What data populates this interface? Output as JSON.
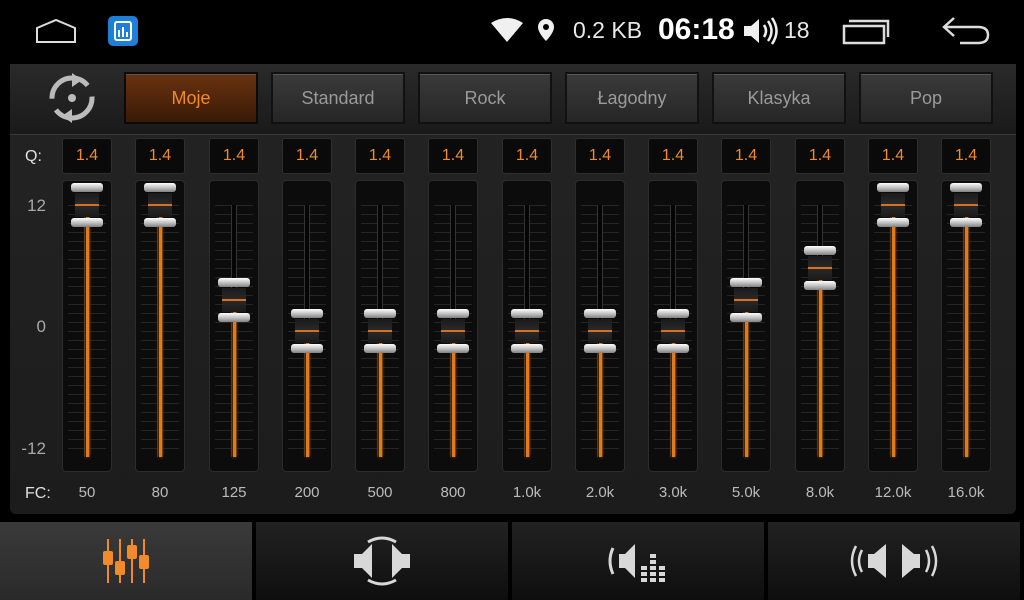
{
  "status": {
    "net_speed": "0.2 KB",
    "time": "06:18",
    "volume": "18"
  },
  "presets": [
    {
      "label": "Moje",
      "active": true
    },
    {
      "label": "Standard",
      "active": false
    },
    {
      "label": "Rock",
      "active": false
    },
    {
      "label": "Łagodny",
      "active": false
    },
    {
      "label": "Klasyka",
      "active": false
    },
    {
      "label": "Pop",
      "active": false
    }
  ],
  "eq": {
    "q_label": "Q:",
    "fc_label": "FC:",
    "scale": {
      "top": "12",
      "mid": "0",
      "bottom": "-12"
    },
    "range_db": [
      -12,
      12
    ],
    "bands": [
      {
        "fc": "50",
        "q": "1.4",
        "gain_db": 12
      },
      {
        "fc": "80",
        "q": "1.4",
        "gain_db": 12
      },
      {
        "fc": "125",
        "q": "1.4",
        "gain_db": 3
      },
      {
        "fc": "200",
        "q": "1.4",
        "gain_db": 0
      },
      {
        "fc": "500",
        "q": "1.4",
        "gain_db": 0
      },
      {
        "fc": "800",
        "q": "1.4",
        "gain_db": 0
      },
      {
        "fc": "1.0k",
        "q": "1.4",
        "gain_db": 0
      },
      {
        "fc": "2.0k",
        "q": "1.4",
        "gain_db": 0
      },
      {
        "fc": "3.0k",
        "q": "1.4",
        "gain_db": 0
      },
      {
        "fc": "5.0k",
        "q": "1.4",
        "gain_db": 3
      },
      {
        "fc": "8.0k",
        "q": "1.4",
        "gain_db": 6
      },
      {
        "fc": "12.0k",
        "q": "1.4",
        "gain_db": 12
      },
      {
        "fc": "16.0k",
        "q": "1.4",
        "gain_db": 12
      }
    ]
  },
  "colors": {
    "accent": "#f08a2a",
    "background": "#000000"
  },
  "tabs": [
    {
      "icon": "equalizer-icon",
      "active": true
    },
    {
      "icon": "sound-field-icon",
      "active": false
    },
    {
      "icon": "bass-boost-icon",
      "active": false
    },
    {
      "icon": "balance-fader-icon",
      "active": false
    }
  ]
}
